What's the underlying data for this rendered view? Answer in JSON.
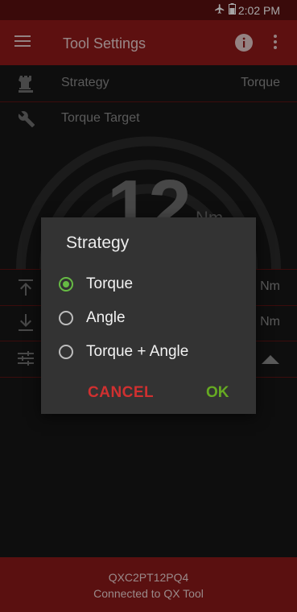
{
  "status_bar": {
    "time": "2:02 PM"
  },
  "app_bar": {
    "title": "Tool Settings"
  },
  "rows": {
    "strategy": {
      "label": "Strategy",
      "value": "Torque"
    },
    "torque_target": {
      "label": "Torque Target"
    },
    "upper_limit": {
      "value": "Nm"
    },
    "lower_limit": {
      "value": "Nm"
    }
  },
  "gauge": {
    "value": "12",
    "unit": "Nm"
  },
  "dialog": {
    "title": "Strategy",
    "options": [
      {
        "label": "Torque",
        "selected": true
      },
      {
        "label": "Angle",
        "selected": false
      },
      {
        "label": "Torque + Angle",
        "selected": false
      }
    ],
    "cancel_label": "CANCEL",
    "ok_label": "OK"
  },
  "footer": {
    "device_id": "QXC2PT12PQ4",
    "connection_status": "Connected to QX Tool"
  },
  "colors": {
    "app_bar": "#8f1a1a",
    "status_bar": "#5a1010",
    "accent_green": "#66bb44",
    "cancel_red": "#d03030"
  }
}
